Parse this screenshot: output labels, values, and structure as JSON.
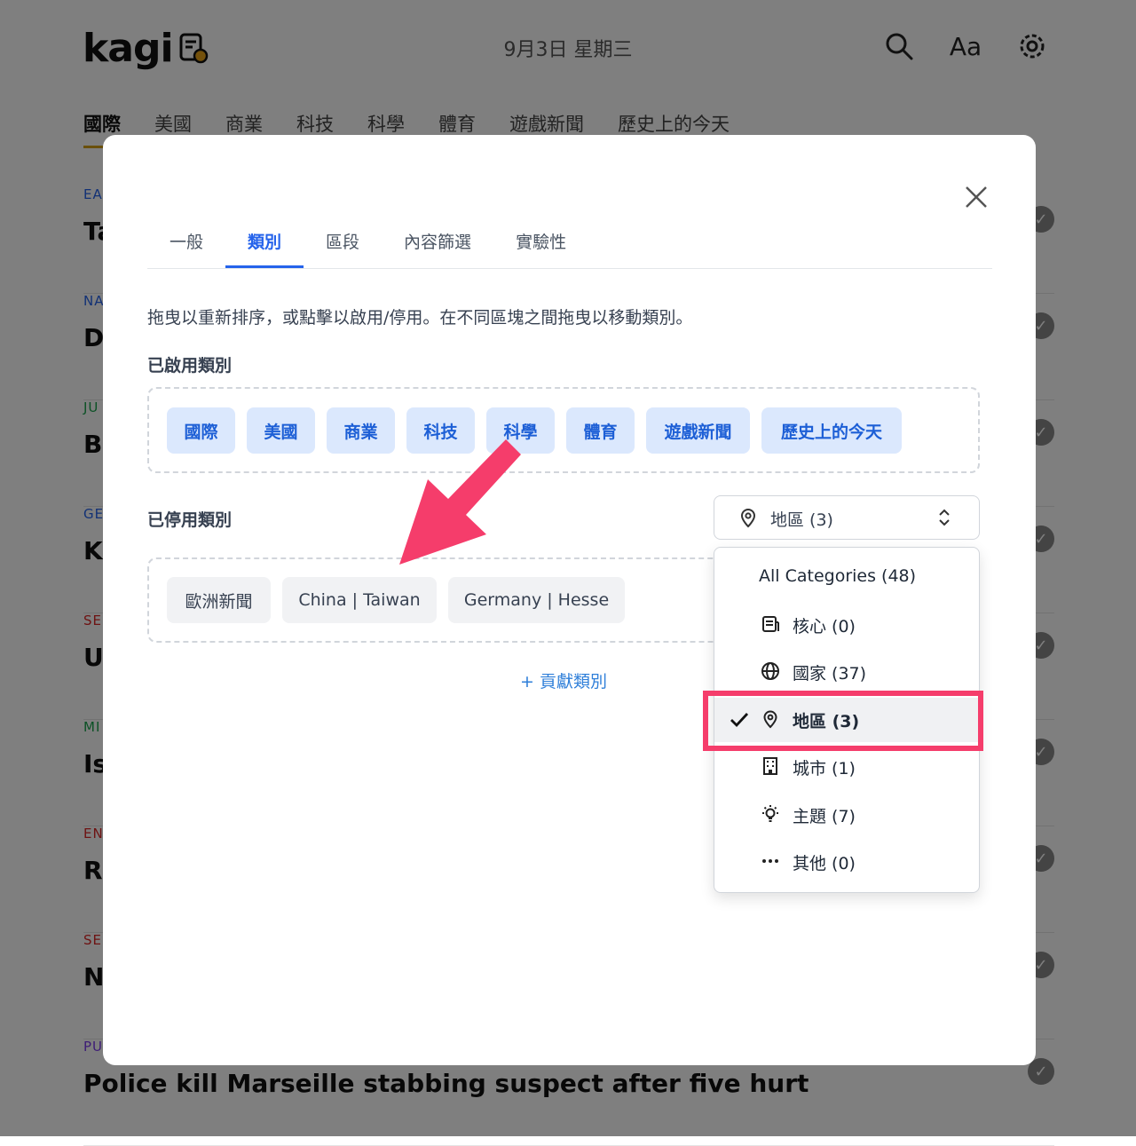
{
  "background": {
    "logo_text": "kagi",
    "date": "9月3日 星期三",
    "font_icon_label": "Aa",
    "nav": [
      "國際",
      "美國",
      "商業",
      "科技",
      "科學",
      "體育",
      "遊戲新聞",
      "歷史上的今天"
    ],
    "stories": [
      {
        "category": "EA",
        "title": "Ta",
        "color": "#2563eb"
      },
      {
        "category": "NA",
        "title": "D",
        "color": "#2563eb"
      },
      {
        "category": "JU",
        "title": "Br",
        "color": "#16a34a"
      },
      {
        "category": "GE",
        "title": "Ki",
        "color": "#2563eb"
      },
      {
        "category": "SE",
        "title": "U",
        "color": "#dc2626"
      },
      {
        "category": "MI",
        "title": "Is",
        "color": "#16a34a"
      },
      {
        "category": "EN",
        "title": "Ru",
        "color": "#dc2626"
      },
      {
        "category": "SE",
        "title": "N",
        "color": "#dc2626"
      },
      {
        "category": "PU",
        "title": "Police kill Marseille stabbing suspect after five hurt",
        "color": "#7c3aed"
      }
    ]
  },
  "modal": {
    "tabs": [
      "一般",
      "類別",
      "區段",
      "內容篩選",
      "實驗性"
    ],
    "active_tab": "類別",
    "description": "拖曳以重新排序，或點擊以啟用/停用。在不同區塊之間拖曳以移動類別。",
    "enabled_title": "已啟用類別",
    "enabled_categories": [
      "國際",
      "美國",
      "商業",
      "科技",
      "科學",
      "體育",
      "遊戲新聞",
      "歷史上的今天"
    ],
    "disabled_title": "已停用類別",
    "disabled_categories": [
      "歐洲新聞",
      "China | Taiwan",
      "Germany | Hesse"
    ],
    "contribute_label": "+ 貢獻類別",
    "filter_select": {
      "value": "地區 (3)",
      "icon": "map-pin-icon"
    },
    "filter_options": [
      {
        "label": "All Categories (48)",
        "icon": "",
        "selected": false
      },
      {
        "label": "核心 (0)",
        "icon": "newspaper-icon",
        "selected": false
      },
      {
        "label": "國家 (37)",
        "icon": "globe-icon",
        "selected": false
      },
      {
        "label": "地區 (3)",
        "icon": "map-pin-icon",
        "selected": true
      },
      {
        "label": "城市 (1)",
        "icon": "building-icon",
        "selected": false
      },
      {
        "label": "主題 (7)",
        "icon": "lightbulb-icon",
        "selected": false
      },
      {
        "label": "其他 (0)",
        "icon": "more-dots-icon",
        "selected": false
      }
    ],
    "accent_color": "#2563eb",
    "annotation_color": "#f53d6b"
  }
}
